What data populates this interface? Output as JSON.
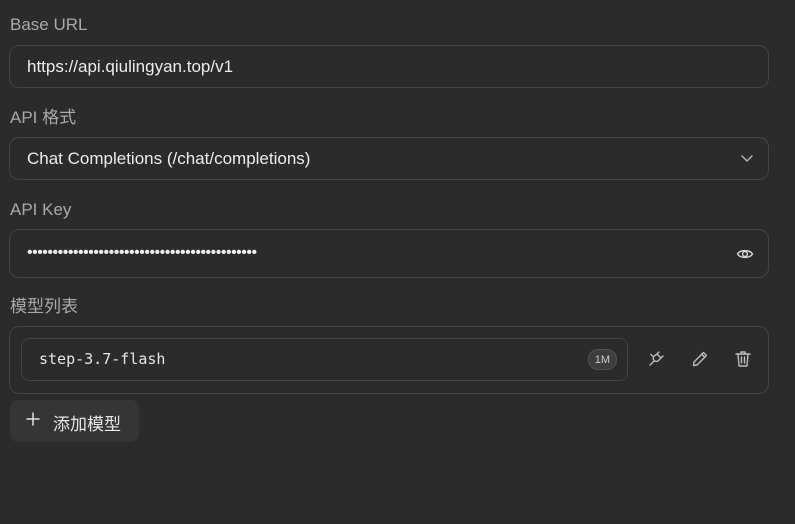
{
  "base_url": {
    "label": "Base URL",
    "value": "https://api.qiulingyan.top/v1"
  },
  "api_format": {
    "label": "API 格式",
    "selected": "Chat Completions (/chat/completions)",
    "icon": "chevron-down-icon"
  },
  "api_key": {
    "label": "API Key",
    "masked_value": "•••••••••••••••••••••••••••••••••••••••••••••",
    "icon": "eye-icon"
  },
  "models": {
    "label": "模型列表",
    "items": [
      {
        "name": "step-3.7-flash",
        "badge": "1M"
      }
    ],
    "add_label": "添加模型"
  }
}
